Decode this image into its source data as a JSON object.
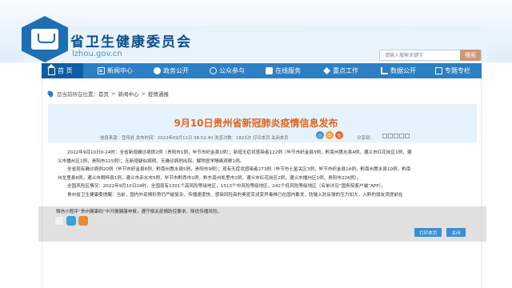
{
  "header": {
    "site_title": "省卫生健康委员会",
    "site_url": "lzhou.gov.cn",
    "search_placeholder": "请输入搜索关键字",
    "search_button": "搜索"
  },
  "nav": [
    {
      "label": "首 页",
      "icon": "home-icon"
    },
    {
      "label": "新闻中心",
      "icon": "news-icon"
    },
    {
      "label": "政务公开",
      "icon": "gov-icon"
    },
    {
      "label": "公众参与",
      "icon": "public-icon"
    },
    {
      "label": "在线服务",
      "icon": "chat-icon"
    },
    {
      "label": "重点工作",
      "icon": "star-icon"
    },
    {
      "label": "数据公开",
      "icon": "data-icon"
    },
    {
      "label": "专题专栏",
      "icon": "topic-icon"
    }
  ],
  "breadcrumb": {
    "prefix": "您当前所在位置：",
    "items": [
      "首页",
      "新闻中心",
      "疫情通报"
    ],
    "separator": ">"
  },
  "article": {
    "title": "9月10日贵州省新冠肺炎疫情信息发布",
    "meta": "信息来源：宣传处    发布时间：2022年09月11日 08:52:40    浏览次数：1823次  打印本页  关闭本页",
    "font_size_buttons": [
      "小",
      "中",
      "大"
    ],
    "share_label": "分享到："
  },
  "content": [
    "2022年9月10日0-24时：全省新增确诊病例2例（贵阳市1例，毕节市织金县1例）；新增无症状感染者122例（毕节市织金县3例，黔南州惠水县4例，遵义市红花岗区1例，遵",
    "义市播州区1例，贵阳市115例）；无新增疑似病例。无确诊病例出院，解除医学隔离观察1例。",
    "全省现有确诊病例20例（毕节市织金县6例，黔南州惠水县5例，贵阳市9例）；现有无症状感染者273例（毕节市七星关区3例，毕节市织金县14例，黔南州惠水县10例，黔南",
    "州龙里县6例，遵义市桐梓县1例，遵义市赤水市5例，毕节市黔西市1例，黔东南州凯里市1例，遵义市红花岗区2例，遵义市播州区1例，贵阳市226例）。",
    "全国风险区情况：2022年9月10日24时，全国现有1301个高风险等级地区，1513个中风险等级地区，242个低风险等级地区（名单详见“国务院客户端”APP）。",
    "贵州省卫生健康委提醒：当前，国内外疫情形势仍严峻复杂，传播速度快、感染风险高的奥密克戎变异毒株已在国内散发，防输入防反弹的压力加大，入黔的朋友须提前在"
  ],
  "overlay_text": "微信小程序“贵州健康码”中开展健康申报，遵守相关疫情防控要求，降低传播风险。",
  "buttons": {
    "print": "打印本页",
    "close": "关闭"
  }
}
